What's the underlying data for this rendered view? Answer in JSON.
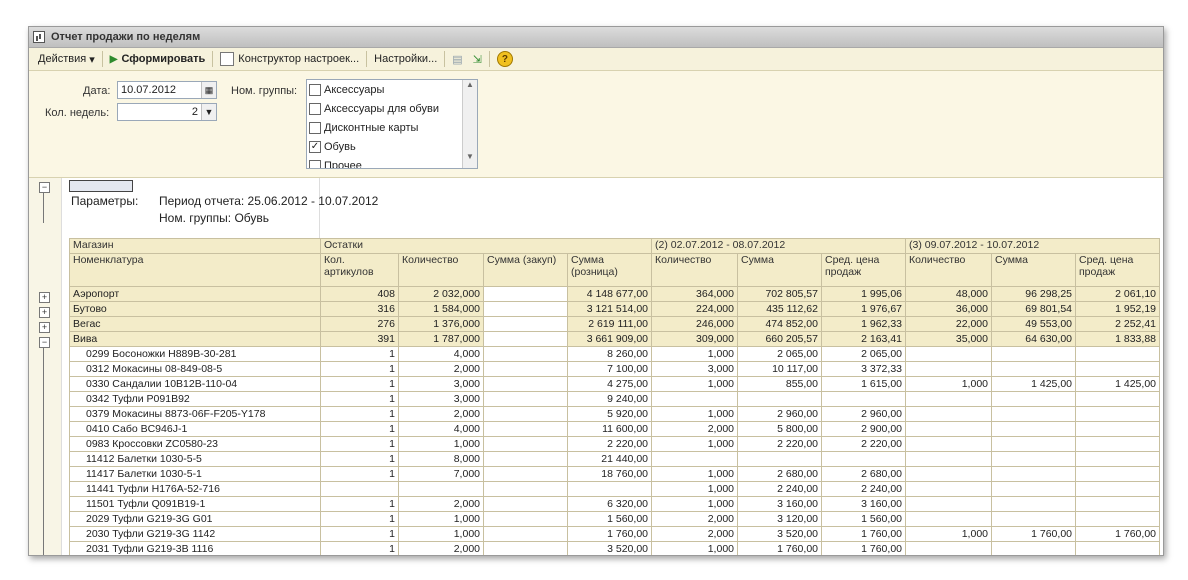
{
  "window": {
    "title": "Отчет продажи по неделям"
  },
  "toolbar": {
    "actions": "Действия",
    "actions_caret": "▾",
    "generate": "Сформировать",
    "constructor": "Конструктор настроек...",
    "settings": "Настройки...",
    "help": "?"
  },
  "form": {
    "date_label": "Дата:",
    "date_value": "10.07.2012",
    "weeks_label": "Кол. недель:",
    "weeks_value": "2",
    "groups_label": "Ном. группы:",
    "groups": [
      {
        "label": "Аксессуары",
        "checked": false
      },
      {
        "label": "Аксессуары для обуви",
        "checked": false
      },
      {
        "label": "Дисконтные карты",
        "checked": false
      },
      {
        "label": "Обувь",
        "checked": true
      },
      {
        "label": "Прочее",
        "checked": false
      }
    ]
  },
  "report": {
    "params_label": "Параметры:",
    "period": "Период отчета: 25.06.2012 - 10.07.2012",
    "groups_param": "Ном. группы: Обувь",
    "header": {
      "store": "Магазин",
      "item": "Номенклатура",
      "stock": "Остатки",
      "stock_cols": [
        "Кол. артикулов",
        "Количество",
        "Сумма (закуп)",
        "Сумма (розница)"
      ],
      "week2": "(2) 02.07.2012 - 08.07.2012",
      "week3": "(3) 09.07.2012 - 10.07.2012",
      "week_cols": [
        "Количество",
        "Сумма",
        "Сред. цена продаж"
      ]
    },
    "groups": [
      {
        "name": "Аэропорт",
        "c": [
          "408",
          "2 032,000",
          "",
          "4 148 677,00",
          "364,000",
          "702 805,57",
          "1 995,06",
          "48,000",
          "96 298,25",
          "2 061,10"
        ]
      },
      {
        "name": "Бутово",
        "c": [
          "316",
          "1 584,000",
          "",
          "3 121 514,00",
          "224,000",
          "435 112,62",
          "1 976,67",
          "36,000",
          "69 801,54",
          "1 952,19"
        ]
      },
      {
        "name": "Вегас",
        "c": [
          "276",
          "1 376,000",
          "",
          "2 619 111,00",
          "246,000",
          "474 852,00",
          "1 962,33",
          "22,000",
          "49 553,00",
          "2 252,41"
        ]
      },
      {
        "name": "Вива",
        "c": [
          "391",
          "1 787,000",
          "",
          "3 661 909,00",
          "309,000",
          "660 205,57",
          "2 163,41",
          "35,000",
          "64 630,00",
          "1 833,88"
        ]
      }
    ],
    "rows": [
      {
        "name": "0299 Босоножки H889B-30-281",
        "c": [
          "1",
          "4,000",
          "",
          "8 260,00",
          "1,000",
          "2 065,00",
          "2 065,00",
          "",
          "",
          ""
        ]
      },
      {
        "name": "0312 Мокасины 08-849-08-5",
        "c": [
          "1",
          "2,000",
          "",
          "7 100,00",
          "3,000",
          "10 117,00",
          "3 372,33",
          "",
          "",
          ""
        ]
      },
      {
        "name": "0330 Сандалии 10B12B-110-04",
        "c": [
          "1",
          "3,000",
          "",
          "4 275,00",
          "1,000",
          "855,00",
          "1 615,00",
          "1,000",
          "1 425,00",
          "1 425,00"
        ]
      },
      {
        "name": "0342 Туфли P091B92",
        "c": [
          "1",
          "3,000",
          "",
          "9 240,00",
          "",
          "",
          "",
          "",
          "",
          ""
        ]
      },
      {
        "name": "0379 Мокасины 8873-06F-F205-Y178",
        "c": [
          "1",
          "2,000",
          "",
          "5 920,00",
          "1,000",
          "2 960,00",
          "2 960,00",
          "",
          "",
          ""
        ]
      },
      {
        "name": "0410 Сабо BC946J-1",
        "c": [
          "1",
          "4,000",
          "",
          "11 600,00",
          "2,000",
          "5 800,00",
          "2 900,00",
          "",
          "",
          ""
        ]
      },
      {
        "name": "0983 Кроссовки ZC0580-23",
        "c": [
          "1",
          "1,000",
          "",
          "2 220,00",
          "1,000",
          "2 220,00",
          "2 220,00",
          "",
          "",
          ""
        ]
      },
      {
        "name": "11412 Балетки 1030-5-5",
        "c": [
          "1",
          "8,000",
          "",
          "21 440,00",
          "",
          "",
          "",
          "",
          "",
          ""
        ]
      },
      {
        "name": "11417 Балетки 1030-5-1",
        "c": [
          "1",
          "7,000",
          "",
          "18 760,00",
          "1,000",
          "2 680,00",
          "2 680,00",
          "",
          "",
          ""
        ]
      },
      {
        "name": "11441 Туфли H176A-52-716",
        "c": [
          "",
          "",
          "",
          "",
          "1,000",
          "2 240,00",
          "2 240,00",
          "",
          "",
          ""
        ]
      },
      {
        "name": "11501 Туфли Q091B19-1",
        "c": [
          "1",
          "2,000",
          "",
          "6 320,00",
          "1,000",
          "3 160,00",
          "3 160,00",
          "",
          "",
          ""
        ]
      },
      {
        "name": "2029 Туфли G219-3G G01",
        "c": [
          "1",
          "1,000",
          "",
          "1 560,00",
          "2,000",
          "3 120,00",
          "1 560,00",
          "",
          "",
          ""
        ]
      },
      {
        "name": "2030 Туфли G219-3G 1142",
        "c": [
          "1",
          "1,000",
          "",
          "1 760,00",
          "2,000",
          "3 520,00",
          "1 760,00",
          "1,000",
          "1 760,00",
          "1 760,00"
        ]
      },
      {
        "name": "2031 Туфли G219-3B 1116",
        "c": [
          "1",
          "2,000",
          "",
          "3 520,00",
          "1,000",
          "1 760,00",
          "1 760,00",
          "",
          "",
          ""
        ]
      }
    ]
  }
}
